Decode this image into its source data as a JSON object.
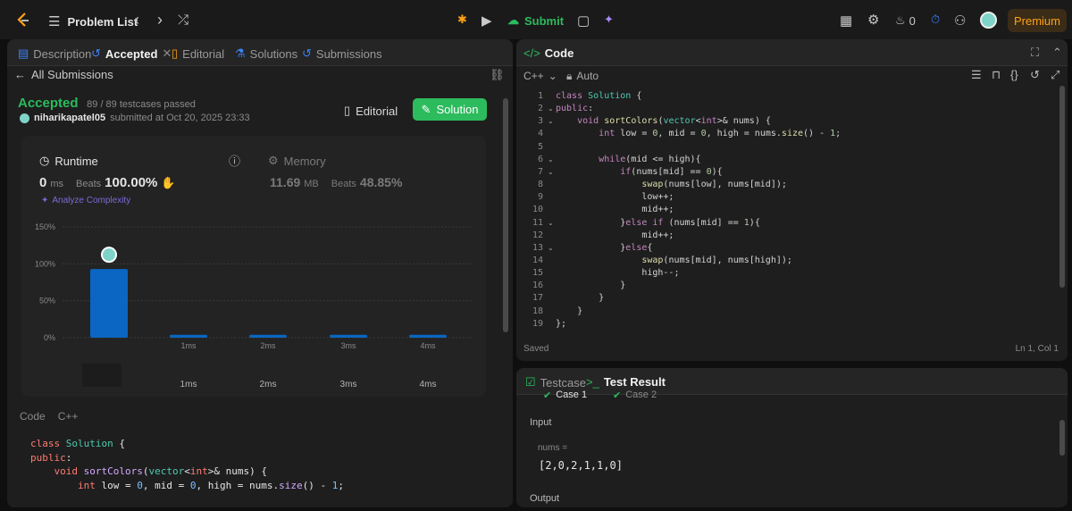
{
  "topbar": {
    "problem_list": "Problem List",
    "submit": "Submit",
    "streak_count": "0",
    "premium": "Premium"
  },
  "left": {
    "tabs": [
      {
        "label": "Description"
      },
      {
        "label": "Accepted"
      },
      {
        "label": "Editorial"
      },
      {
        "label": "Solutions"
      },
      {
        "label": "Submissions"
      }
    ],
    "all_submissions": "All Submissions",
    "status": "Accepted",
    "testcases": "89 / 89 testcases passed",
    "user": "niharikapatel05",
    "submitted": "submitted at Oct 20, 2025 23:33",
    "editorial_btn": "Editorial",
    "solution_btn": "Solution",
    "runtime": {
      "label": "Runtime",
      "value": "0",
      "unit": "ms",
      "beats_label": "Beats",
      "beats": "100.00%"
    },
    "memory": {
      "label": "Memory",
      "value": "11.69",
      "unit": "MB",
      "beats_label": "Beats",
      "beats": "48.85%"
    },
    "analyze": "Analyze Complexity",
    "code_label": "Code",
    "code_lang": "C++",
    "code_lines": [
      "class Solution {",
      "public:",
      "    void sortColors(vector<int>& nums) {",
      "        int low = 0, mid = 0, high = nums.size() - 1;"
    ]
  },
  "chart_data": {
    "type": "bar",
    "yticks": [
      "150%",
      "100%",
      "50%",
      "0%"
    ],
    "ylim": [
      0,
      150
    ],
    "bar_labels": [
      "",
      "1ms",
      "2ms",
      "3ms",
      "4ms"
    ],
    "categories": [
      "",
      "1ms",
      "2ms",
      "3ms",
      "4ms"
    ],
    "values": [
      93,
      4,
      4,
      4,
      4
    ],
    "colors": {
      "bar": "#0a66c2",
      "grid": "#3a3a3a"
    }
  },
  "editor": {
    "title": "Code",
    "language": "C++",
    "auto": "Auto",
    "saved": "Saved",
    "cursor": "Ln 1, Col 1",
    "lines": [
      "class Solution {",
      "public:",
      "    void sortColors(vector<int>& nums) {",
      "        int low = 0, mid = 0, high = nums.size() - 1;",
      "",
      "        while(mid <= high){",
      "            if(nums[mid] == 0){",
      "                swap(nums[low], nums[mid]);",
      "                low++;",
      "                mid++;",
      "            }else if (nums[mid] == 1){",
      "                mid++;",
      "            }else{",
      "                swap(nums[mid], nums[high]);",
      "                high--;",
      "            }",
      "        }",
      "    }",
      "};"
    ]
  },
  "result": {
    "tab_testcase": "Testcase",
    "tab_result": "Test Result",
    "case1": "Case 1",
    "case2": "Case 2",
    "input_label": "Input",
    "var_label": "nums =",
    "var_value": "[2,0,2,1,1,0]",
    "output_label": "Output"
  }
}
